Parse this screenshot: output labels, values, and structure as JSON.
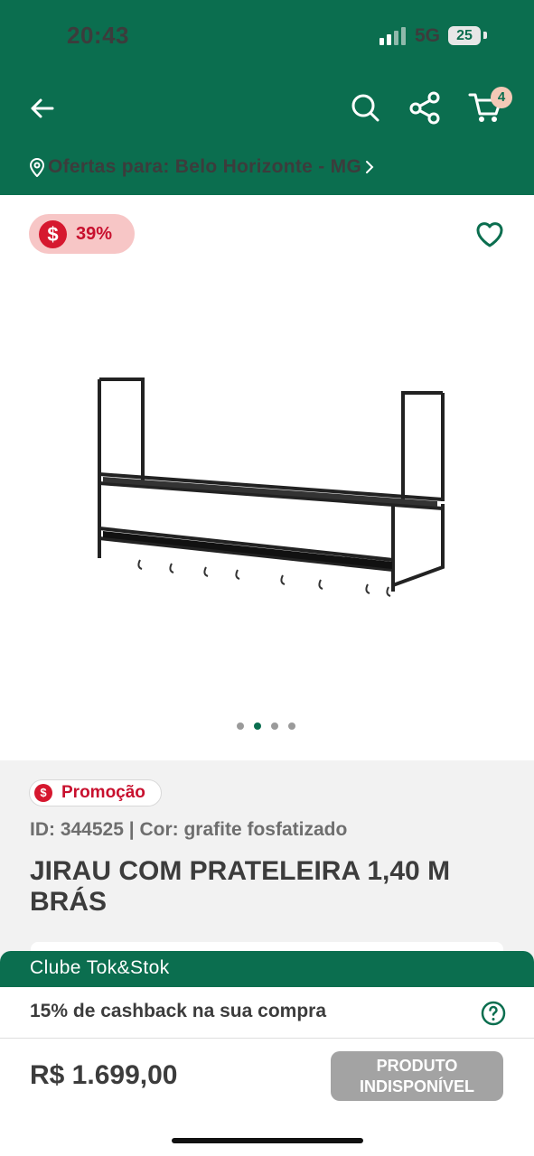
{
  "status_bar": {
    "time": "20:43",
    "network": "5G",
    "battery": "25"
  },
  "header": {
    "cart_count": "4",
    "location_text": "Ofertas para: Belo Horizonte - MG"
  },
  "product": {
    "discount": "39%",
    "currency_icon": "$",
    "promo_label": "Promoção",
    "id_color_text": "ID: 344525 | Cor: grafite fosfatizado",
    "title": "JIRAU COM PRATELEIRA 1,40 M BRÁS"
  },
  "club": {
    "title": "Clube Tok&Stok",
    "cashback": "15% de cashback na sua compra"
  },
  "buy": {
    "price": "R$ 1.699,00",
    "status": "PRODUTO INDISPONÍVEL"
  },
  "colors": {
    "brand": "#0b6e4f",
    "sale": "#c8102e",
    "disabled": "#a3a3a3"
  }
}
